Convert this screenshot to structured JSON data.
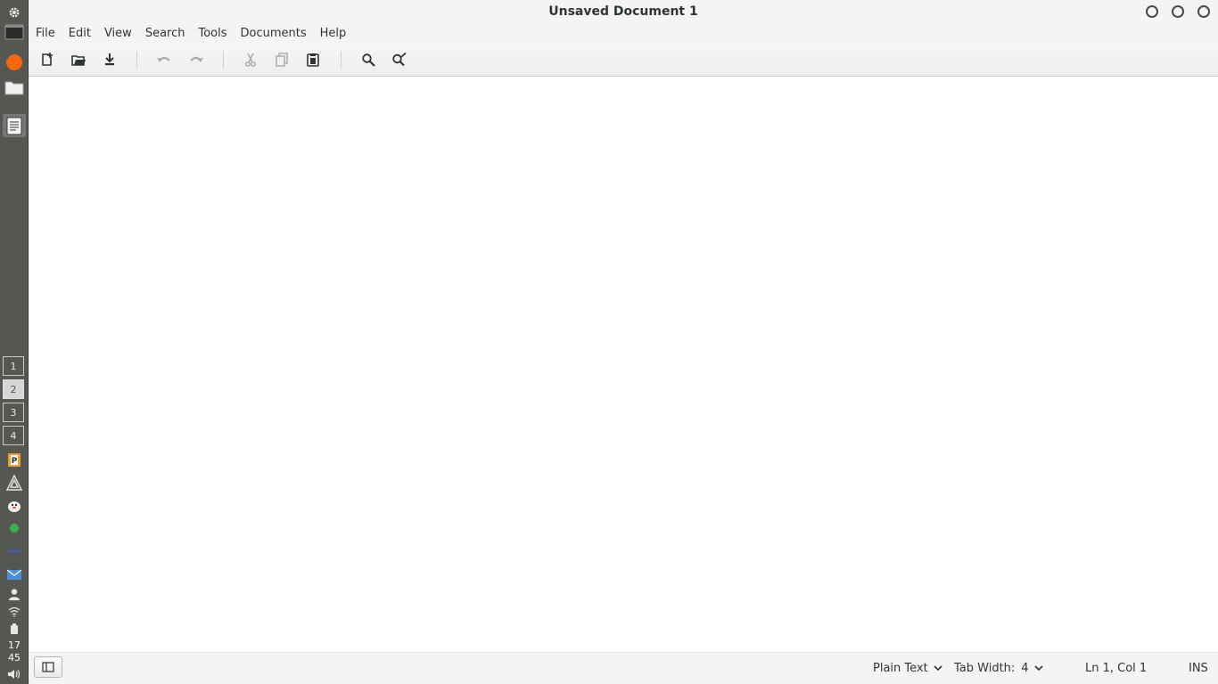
{
  "window": {
    "title": "Unsaved Document 1"
  },
  "menu": {
    "items": [
      "File",
      "Edit",
      "View",
      "Search",
      "Tools",
      "Documents",
      "Help"
    ]
  },
  "toolbar": {
    "buttons": [
      "new-document-icon",
      "open-document-icon",
      "save-document-icon",
      "undo-icon",
      "redo-icon",
      "cut-icon",
      "copy-icon",
      "paste-icon",
      "search-icon",
      "find-replace-icon"
    ]
  },
  "dock": {
    "workspaces": [
      "1",
      "2",
      "3",
      "4"
    ],
    "active_workspace": "2",
    "clock": {
      "hour": "17",
      "minute": "45"
    }
  },
  "statusbar": {
    "language": "Plain Text",
    "tab_width_label": "Tab Width:",
    "tab_width_value": "4",
    "cursor_position": "Ln 1, Col 1",
    "insert_mode": "INS"
  },
  "colors": {
    "dock": "#555753",
    "chrome": "#f4f4f3",
    "text": "#2e3436",
    "editor": "#ffffff"
  }
}
